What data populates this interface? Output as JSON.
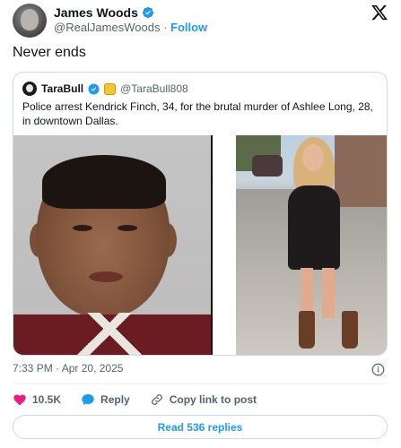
{
  "author": {
    "name": "James Woods",
    "handle": "@RealJamesWoods",
    "separator": "·",
    "follow_label": "Follow"
  },
  "tweet": {
    "text": "Never ends",
    "time": "7:33 PM",
    "date": "Apr 20, 2025",
    "meta_separator": "·"
  },
  "quote": {
    "name": "TaraBull",
    "handle": "@TaraBull808",
    "text": "Police arrest Kendrick Finch, 34, for the brutal murder of Ashlee Long, 28, in downtown Dallas."
  },
  "actions": {
    "likes": "10.5K",
    "reply_label": "Reply",
    "copy_label": "Copy link to post"
  },
  "replies_button": "Read 536 replies",
  "colors": {
    "accent": "#1d9bf0",
    "like": "#f91880",
    "muted": "#536471"
  },
  "icons": [
    "verified-badge-icon",
    "x-logo-icon",
    "info-icon",
    "heart-icon",
    "reply-bubble-icon",
    "link-icon"
  ]
}
